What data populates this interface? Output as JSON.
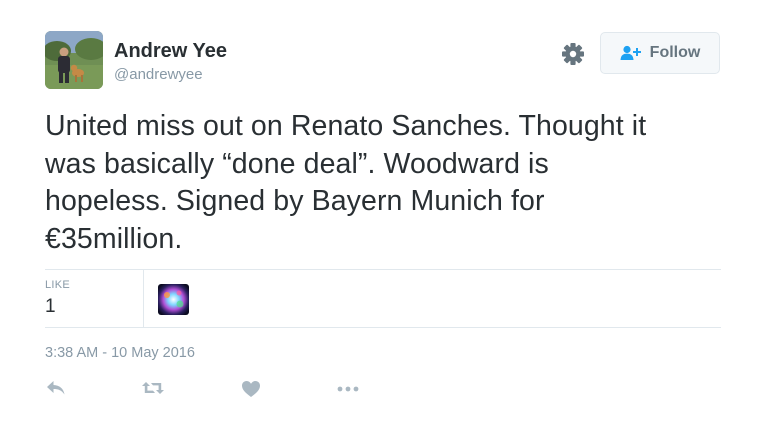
{
  "user": {
    "name": "Andrew Yee",
    "handle": "@andrewyee",
    "avatar": "profile-photo-dog-on-grass"
  },
  "header": {
    "settings_icon": "gear-icon",
    "follow_icon": "add-user-icon",
    "follow_label": "Follow"
  },
  "tweet": {
    "lines": [
      "United miss out on Renato Sanches. Thought it",
      "was basically “done deal”. Woodward is",
      "hopeless. Signed by Bayern Munich for",
      "€35million."
    ]
  },
  "stats": {
    "like_label": "LIKE",
    "like_count": "1",
    "liker_avatar": "colorful-avatar"
  },
  "timestamp": "3:38 AM - 10 May 2016",
  "actions": [
    {
      "name": "reply",
      "icon": "reply-icon"
    },
    {
      "name": "retweet",
      "icon": "retweet-icon"
    },
    {
      "name": "like",
      "icon": "heart-icon"
    },
    {
      "name": "more",
      "icon": "more-icon"
    }
  ],
  "colors": {
    "text": "#292f33",
    "muted": "#8899a6",
    "icon": "#aab8c2",
    "border": "#e1e8ed",
    "follow_icon": "#1da1f2"
  }
}
